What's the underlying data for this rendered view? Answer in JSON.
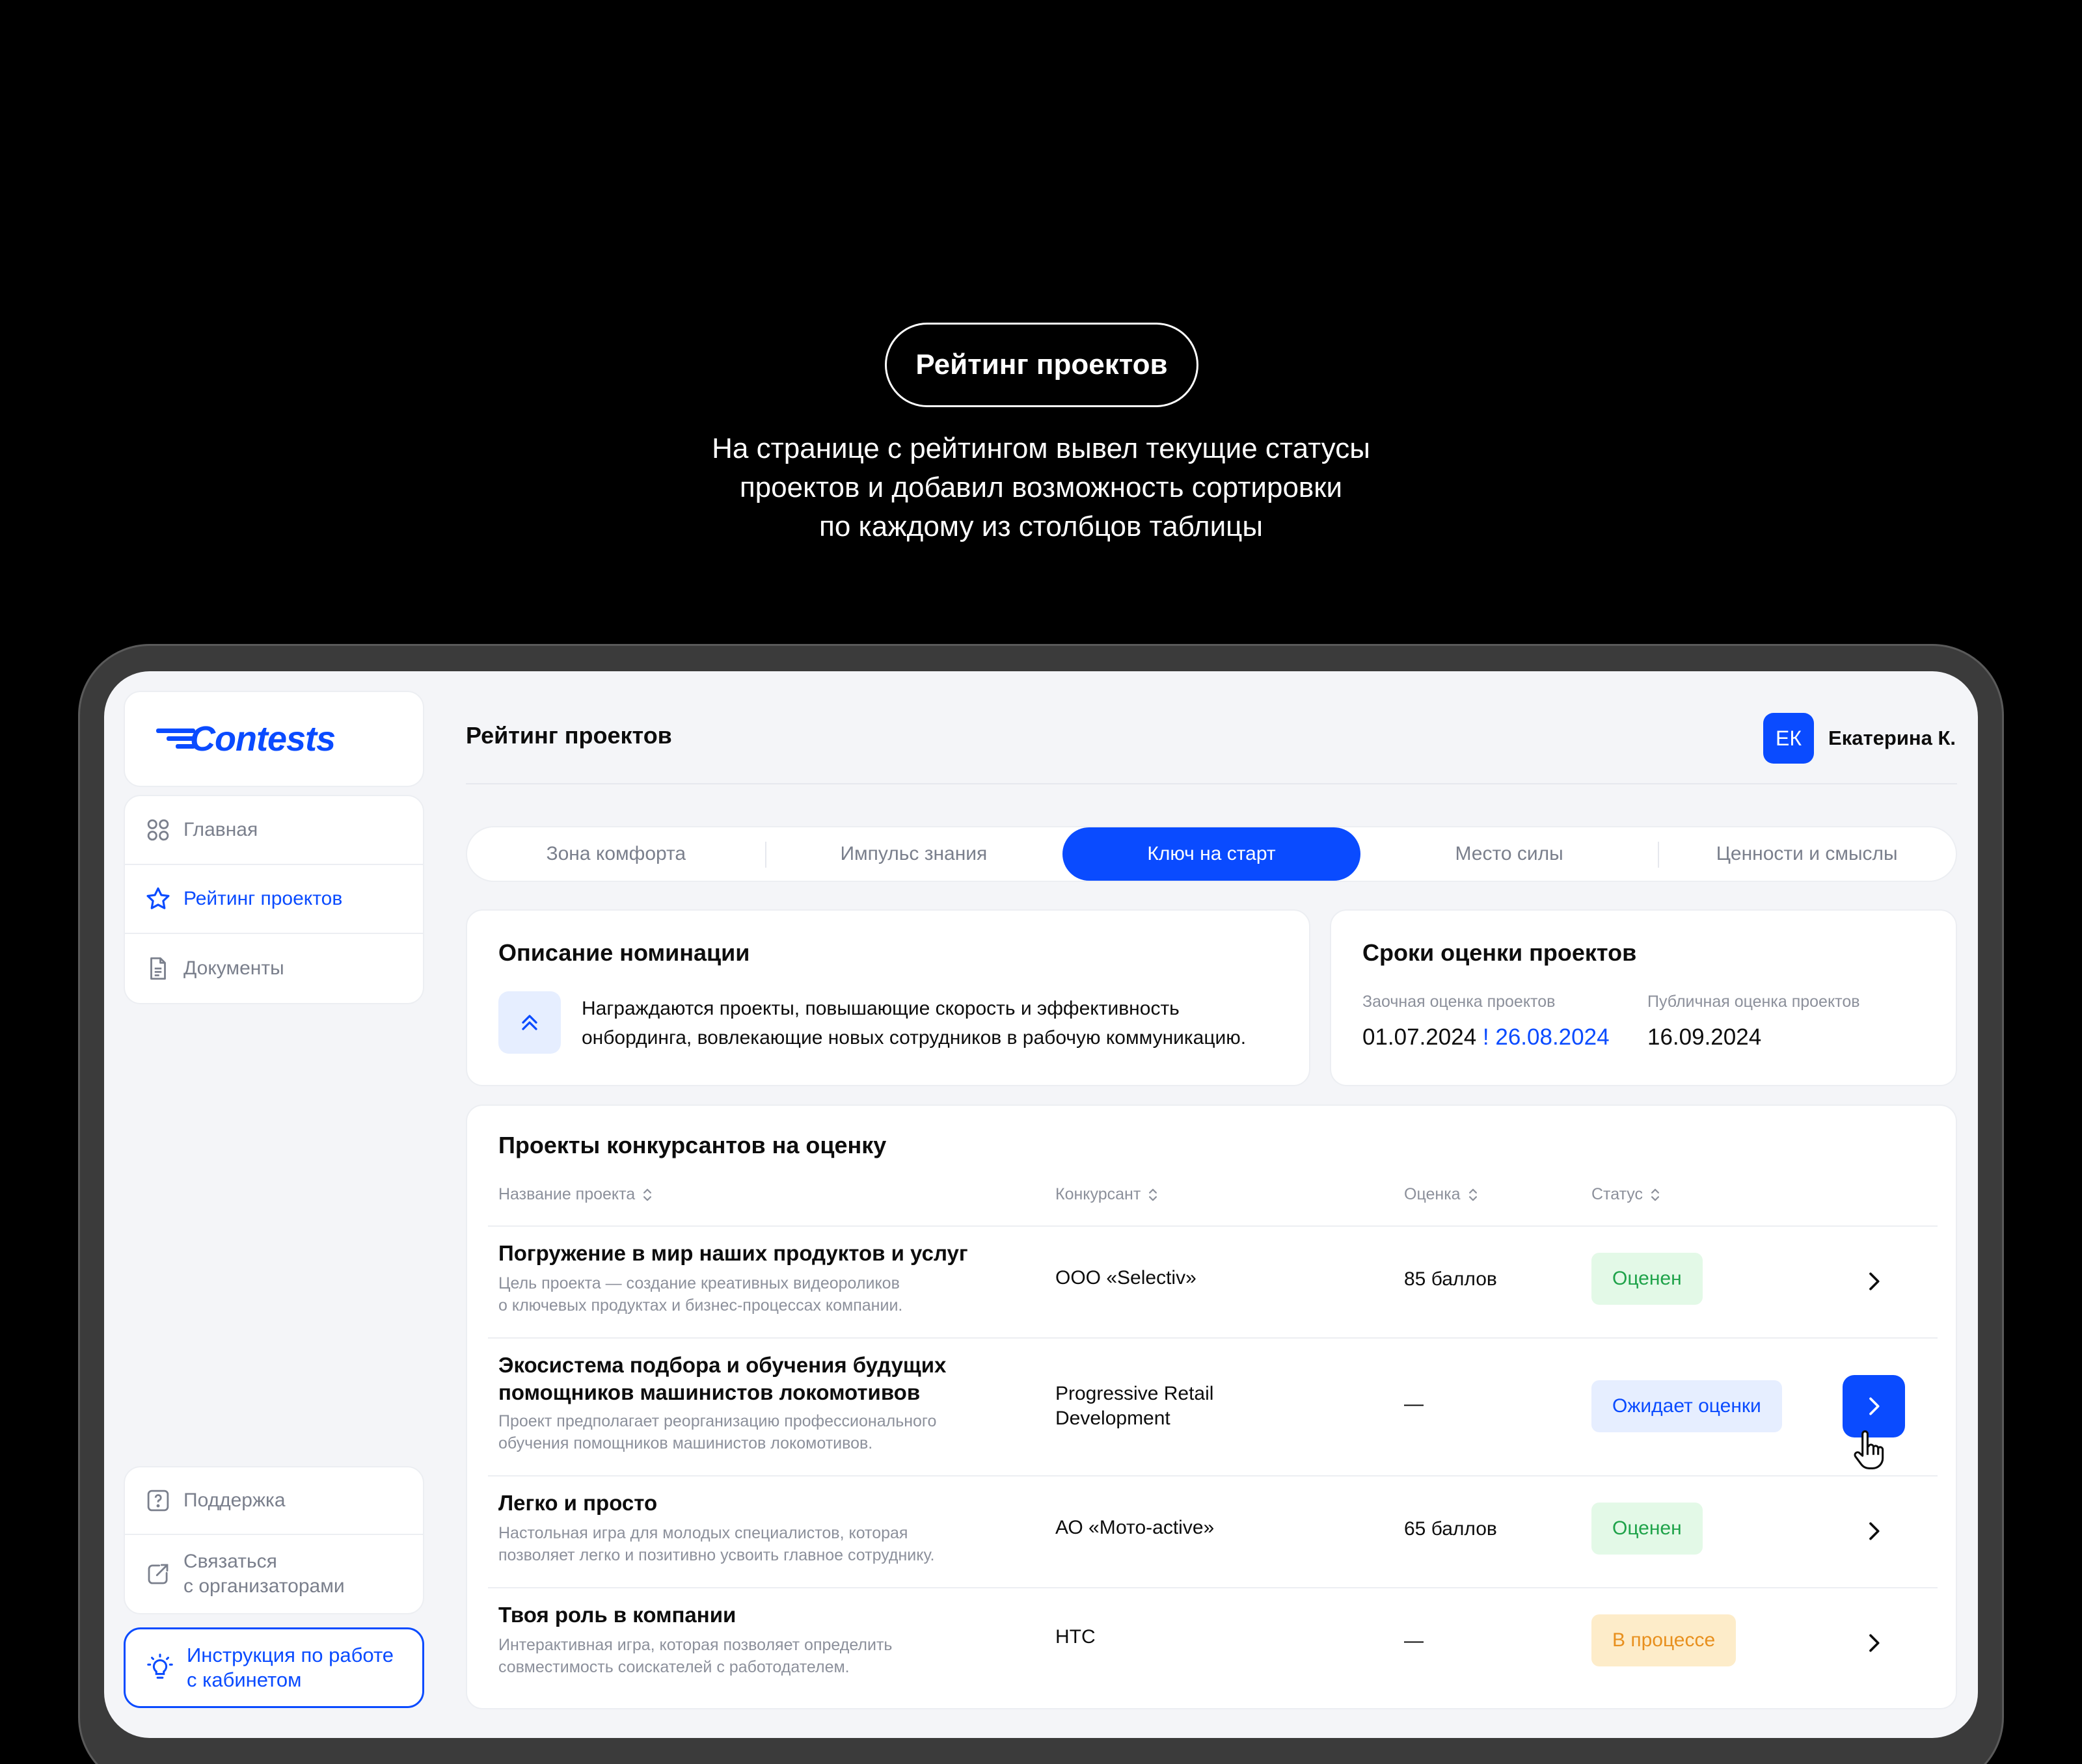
{
  "hero": {
    "pill": "Рейтинг проектов",
    "lines": [
      "На странице с рейтингом вывел текущие статусы",
      "проектов и добавил возможность сортировки",
      "по каждому из столбцов таблицы"
    ]
  },
  "app": {
    "logo": "Contests",
    "page_title": "Рейтинг проектов",
    "user": {
      "initials": "ЕК",
      "name": "Екатерина К."
    },
    "accent": "#0a4bff"
  },
  "sidebar": {
    "items": [
      {
        "label": "Главная",
        "icon": "grid-icon",
        "active": false
      },
      {
        "label": "Рейтинг проектов",
        "icon": "star-icon",
        "active": true
      },
      {
        "label": "Документы",
        "icon": "document-icon",
        "active": false
      }
    ],
    "support": "Поддержка",
    "contact": [
      "Связаться",
      "с организаторами"
    ],
    "guide": [
      "Инструкция по работе",
      "с кабинетом"
    ]
  },
  "tabs": [
    {
      "label": "Зона комфорта",
      "active": false
    },
    {
      "label": "Импульс знания",
      "active": false
    },
    {
      "label": "Ключ на старт",
      "active": true
    },
    {
      "label": "Место силы",
      "active": false
    },
    {
      "label": "Ценности и смыслы",
      "active": false
    }
  ],
  "description": {
    "title": "Описание номинации",
    "lines": [
      "Награждаются проекты, повышающие скорость и эффективность",
      "онбординга, вовлекающие новых сотрудников в рабочую коммуникацию."
    ]
  },
  "deadlines": {
    "title": "Сроки оценки проектов",
    "remote_label": "Заочная оценка проектов",
    "remote_from": "01.07.2024",
    "remote_sep": "!",
    "remote_to": "26.08.2024",
    "public_label": "Публичная оценка проектов",
    "public_date": "16.09.2024"
  },
  "projects": {
    "title": "Проекты конкурсантов на оценку",
    "columns": [
      "Название проекта",
      "Конкурсант",
      "Оценка",
      "Статус"
    ],
    "rows": [
      {
        "title": [
          "Погружение в мир наших продуктов и услуг"
        ],
        "desc": [
          "Цель проекта — создание креативных видеороликов",
          "о ключевых продуктах и бизнес-процессах компании."
        ],
        "contestant": [
          "ООО «Selectiv»"
        ],
        "score": "85 баллов",
        "status": "Оценен"
      },
      {
        "title": [
          "Экосистема подбора и обучения будущих",
          "помощников машинистов локомотивов"
        ],
        "desc": [
          "Проект предполагает реорганизацию профессионального",
          "обучения помощников машинистов локомотивов."
        ],
        "contestant": [
          "Progressive Retail",
          "Development"
        ],
        "score": "—",
        "status": "Ожидает оценки"
      },
      {
        "title": [
          "Легко и просто"
        ],
        "desc": [
          "Настольная игра для молодых специалистов, которая",
          "позволяет легко и позитивно усвоить главное сотруднику."
        ],
        "contestant": [
          "АО «Мото-active»"
        ],
        "score": "65 баллов",
        "status": "Оценен"
      },
      {
        "title": [
          "Твоя роль в компании"
        ],
        "desc": [
          "Интерактивная игра, которая позволяет определить",
          "совместимость соискателей с работодателем."
        ],
        "contestant": [
          "НТС"
        ],
        "score": "—",
        "status": "В процессе"
      }
    ]
  }
}
